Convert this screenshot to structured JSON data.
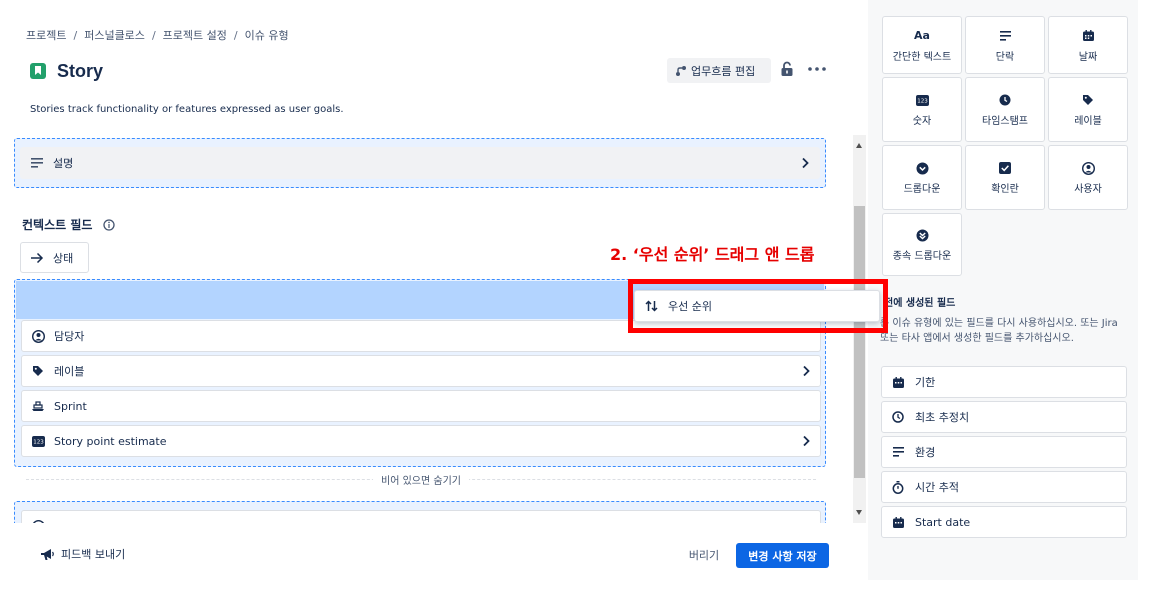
{
  "breadcrumb": [
    "프로젝트",
    "퍼스널클로스",
    "프로젝트 설정",
    "이슈 유형"
  ],
  "breadcrumb_separator": "/",
  "header": {
    "title": "Story",
    "workflow_button": "업무흐름 편집",
    "description": "Stories track functionality or features expressed as user goals."
  },
  "fields": {
    "description_field": "설명",
    "context_heading": "컨텍스트 필드",
    "status_field": "상태",
    "rows": [
      {
        "label": "담당자",
        "icon": "user-circle-icon",
        "has_chevron": false
      },
      {
        "label": "레이블",
        "icon": "tag-icon",
        "has_chevron": true
      },
      {
        "label": "Sprint",
        "icon": "sprint-icon",
        "has_chevron": false
      },
      {
        "label": "Story point estimate",
        "icon": "number-icon",
        "has_chevron": true
      }
    ],
    "hide_when_empty": "비어 있으면 숨기기"
  },
  "footer": {
    "feedback": "피드백 보내기",
    "discard": "버리기",
    "save": "변경 사항 저장"
  },
  "palette": {
    "tiles": [
      {
        "label": "간단한 텍스트",
        "icon": "text-icon",
        "glyph": "Aa"
      },
      {
        "label": "단락",
        "icon": "paragraph-icon"
      },
      {
        "label": "날짜",
        "icon": "calendar-icon"
      },
      {
        "label": "숫자",
        "icon": "number-icon",
        "glyph": "123"
      },
      {
        "label": "타임스탬프",
        "icon": "clock-icon"
      },
      {
        "label": "레이블",
        "icon": "tag-icon"
      },
      {
        "label": "드롭다운",
        "icon": "dropdown-icon"
      },
      {
        "label": "확인란",
        "icon": "checkbox-icon"
      },
      {
        "label": "사용자",
        "icon": "user-icon"
      },
      {
        "label": "종속 드롭다운",
        "icon": "cascading-dropdown-icon"
      }
    ],
    "created_heading": "전에 생성된 필드",
    "created_desc": "른 이슈 유형에 있는 필드를 다시 사용하십시오. 또는 Jira 또는 타사 앱에서 생성한 필드를 추가하십시오.",
    "created_fields": [
      {
        "label": "기한",
        "icon": "calendar-icon"
      },
      {
        "label": "최초 추정치",
        "icon": "clock-icon"
      },
      {
        "label": "환경",
        "icon": "paragraph-icon"
      },
      {
        "label": "시간 추적",
        "icon": "stopwatch-icon"
      },
      {
        "label": "Start date",
        "icon": "calendar-icon"
      }
    ]
  },
  "drag": {
    "annotation": "2. ‘우선 순위’ 드래그 앤 드롭",
    "item_label": "우선 순위",
    "item_icon": "priority-icon"
  },
  "colors": {
    "primary": "#0c66e4",
    "drop_highlight": "#b3d4ff",
    "annotation": "#ff0000",
    "story_icon": "#22a06b"
  }
}
